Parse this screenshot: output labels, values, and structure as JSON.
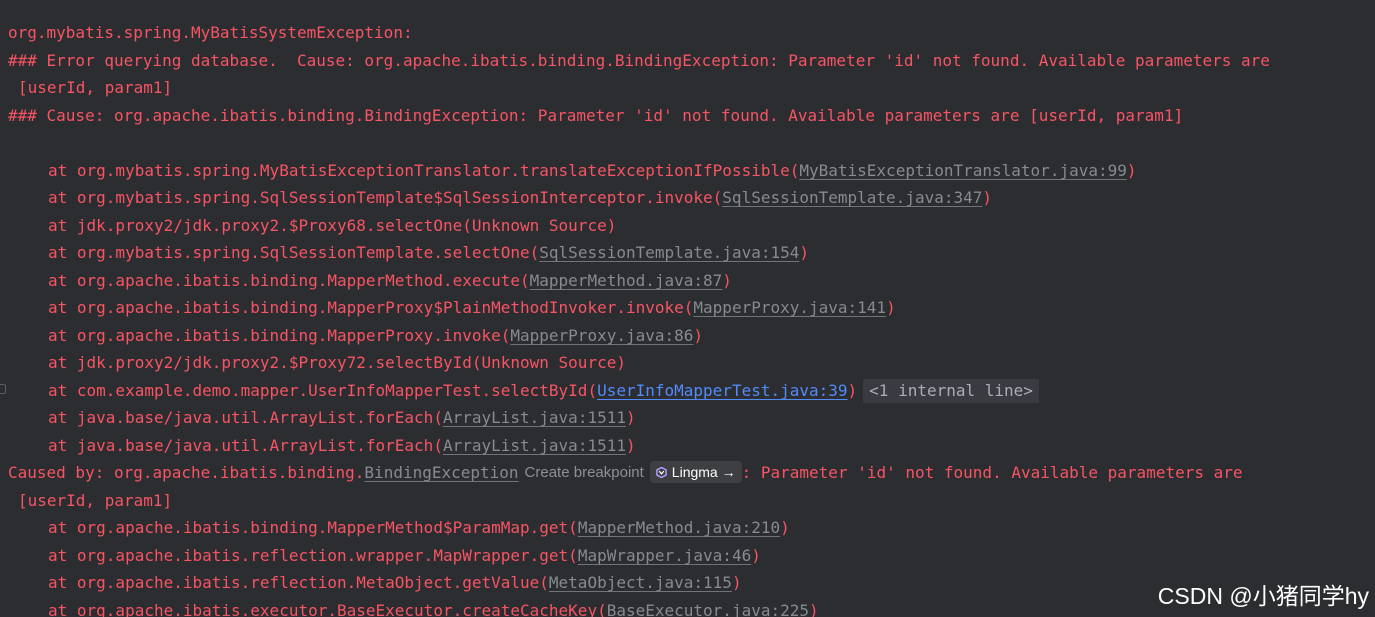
{
  "lines": {
    "l1": "org.mybatis.spring.MyBatisSystemException:",
    "l2": "### Error querying database.  Cause: org.apache.ibatis.binding.BindingException: Parameter 'id' not found. Available parameters are",
    "l3": "[userId, param1]",
    "l4": "### Cause: org.apache.ibatis.binding.BindingException: Parameter 'id' not found. Available parameters are [userId, param1]"
  },
  "frames": [
    {
      "prefix": "at org.mybatis.spring.MyBatisExceptionTranslator.translateExceptionIfPossible(",
      "link": "MyBatisExceptionTranslator.java:99",
      "suffix": ")"
    },
    {
      "prefix": "at org.mybatis.spring.SqlSessionTemplate$SqlSessionInterceptor.invoke(",
      "link": "SqlSessionTemplate.java:347",
      "suffix": ")"
    },
    {
      "text": "at jdk.proxy2/jdk.proxy2.$Proxy68.selectOne(Unknown Source)"
    },
    {
      "prefix": "at org.mybatis.spring.SqlSessionTemplate.selectOne(",
      "link": "SqlSessionTemplate.java:154",
      "suffix": ")"
    },
    {
      "prefix": "at org.apache.ibatis.binding.MapperMethod.execute(",
      "link": "MapperMethod.java:87",
      "suffix": ")"
    },
    {
      "prefix": "at org.apache.ibatis.binding.MapperProxy$PlainMethodInvoker.invoke(",
      "link": "MapperProxy.java:141",
      "suffix": ")"
    },
    {
      "prefix": "at org.apache.ibatis.binding.MapperProxy.invoke(",
      "link": "MapperProxy.java:86",
      "suffix": ")"
    },
    {
      "text": "at jdk.proxy2/jdk.proxy2.$Proxy72.selectById(Unknown Source)"
    },
    {
      "prefix": "at com.example.demo.mapper.UserInfoMapperTest.selectById(",
      "link": "UserInfoMapperTest.java:39",
      "suffix": ")",
      "internal": "<1 internal line>"
    },
    {
      "prefix": "at java.base/java.util.ArrayList.forEach(",
      "link": "ArrayList.java:1511",
      "suffix": ")"
    },
    {
      "prefix": "at java.base/java.util.ArrayList.forEach(",
      "link": "ArrayList.java:1511",
      "suffix": ")"
    }
  ],
  "caused_by": {
    "prefix": "Caused by: org.apache.ibatis.binding.",
    "link": "BindingException",
    "popup_label": "Create breakpoint",
    "lingma_label": "Lingma",
    "lingma_arrow": "→",
    "suffix": ": Parameter 'id' not found. Available parameters are",
    "cont": "[userId, param1]"
  },
  "frames2": [
    {
      "prefix": "at org.apache.ibatis.binding.MapperMethod$ParamMap.get(",
      "link": "MapperMethod.java:210",
      "suffix": ")"
    },
    {
      "prefix": "at org.apache.ibatis.reflection.wrapper.MapWrapper.get(",
      "link": "MapWrapper.java:46",
      "suffix": ")"
    },
    {
      "prefix": "at org.apache.ibatis.reflection.MetaObject.getValue(",
      "link": "MetaObject.java:115",
      "suffix": ")"
    },
    {
      "prefix": "at org.apache.ibatis.executor.BaseExecutor.createCacheKey(",
      "link": "BaseExecutor.java:225",
      "suffix": ")"
    }
  ],
  "watermark": "CSDN @小猪同学hy",
  "colors": {
    "background": "#2b2d30",
    "error_text": "#f75464",
    "link": "#868a91",
    "active_link": "#548af7"
  },
  "icons": {
    "lingma": "lingma-icon",
    "gutter": "fold-marker-icon"
  }
}
